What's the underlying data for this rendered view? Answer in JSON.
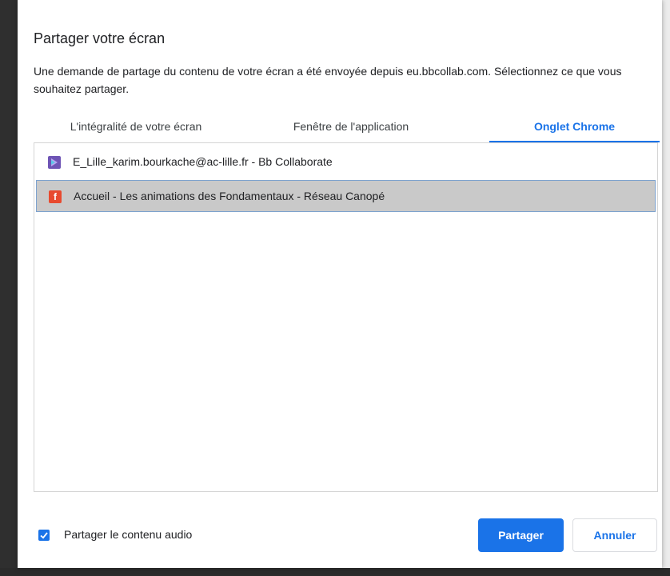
{
  "dialog": {
    "title": "Partager votre écran",
    "description": "Une demande de partage du contenu de votre écran a été envoyée depuis eu.bbcollab.com. Sélectionnez ce que vous souhaitez partager."
  },
  "tabs": [
    {
      "label": "L'intégralité de votre écran",
      "active": false
    },
    {
      "label": "Fenêtre de l'application",
      "active": false
    },
    {
      "label": "Onglet Chrome",
      "active": true
    }
  ],
  "items": [
    {
      "label": "E_Lille_karim.bourkache@ac-lille.fr - Bb Collaborate",
      "icon": "bb-collaborate-icon",
      "selected": false
    },
    {
      "label": "Accueil - Les animations des Fondamentaux - Réseau Canopé",
      "icon": "canope-icon",
      "icon_text": "f",
      "selected": true
    }
  ],
  "footer": {
    "audio_label": "Partager le contenu audio",
    "audio_checked": true,
    "share_label": "Partager",
    "cancel_label": "Annuler"
  },
  "colors": {
    "accent": "#1a73e8",
    "selected_row": "#c9c9c9",
    "bb_icon": "#6e54b5",
    "canope_icon": "#e84a2f"
  }
}
